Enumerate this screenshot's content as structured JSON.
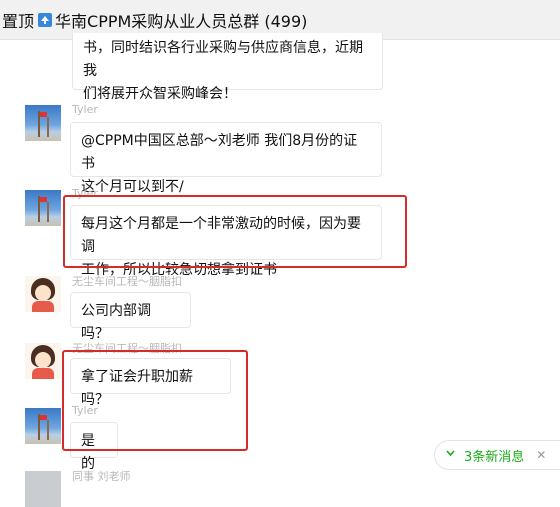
{
  "header": {
    "pin_label": "置顶",
    "pin_icon": "pin-up-icon",
    "title": "华南CPPM采购从业人员总群 (499)"
  },
  "messages": [
    {
      "sender": "",
      "lines": [
        "书，同时结识各行业采购与供应商信息，近期我",
        "们将展开众智采购峰会！"
      ]
    },
    {
      "sender": "Tyler",
      "lines": [
        "@CPPM中国区总部～刘老师 我们8月份的证书",
        "这个月可以到不/"
      ]
    },
    {
      "sender": "Tyler",
      "lines": [
        "每月这个月都是一个非常激动的时候，因为要调",
        "工作，所以比较急切想拿到证书"
      ]
    },
    {
      "sender": "无尘车间工程～胭脂扣",
      "lines": [
        "公司内部调 吗？"
      ]
    },
    {
      "sender": "无尘车间工程～胭脂扣",
      "lines": [
        "拿了证会升职加薪吗？"
      ]
    },
    {
      "sender": "Tyler",
      "lines": [
        "是的"
      ]
    },
    {
      "sender": "同事 刘老师",
      "lines": []
    }
  ],
  "new_messages": {
    "label": "3条新消息",
    "icon": "chevron-down-icon",
    "close_icon": "close-icon"
  },
  "colors": {
    "highlight_box": "#d42b2b",
    "new_message_text": "#1aad19",
    "pin_icon_bg": "#3a86d9"
  }
}
